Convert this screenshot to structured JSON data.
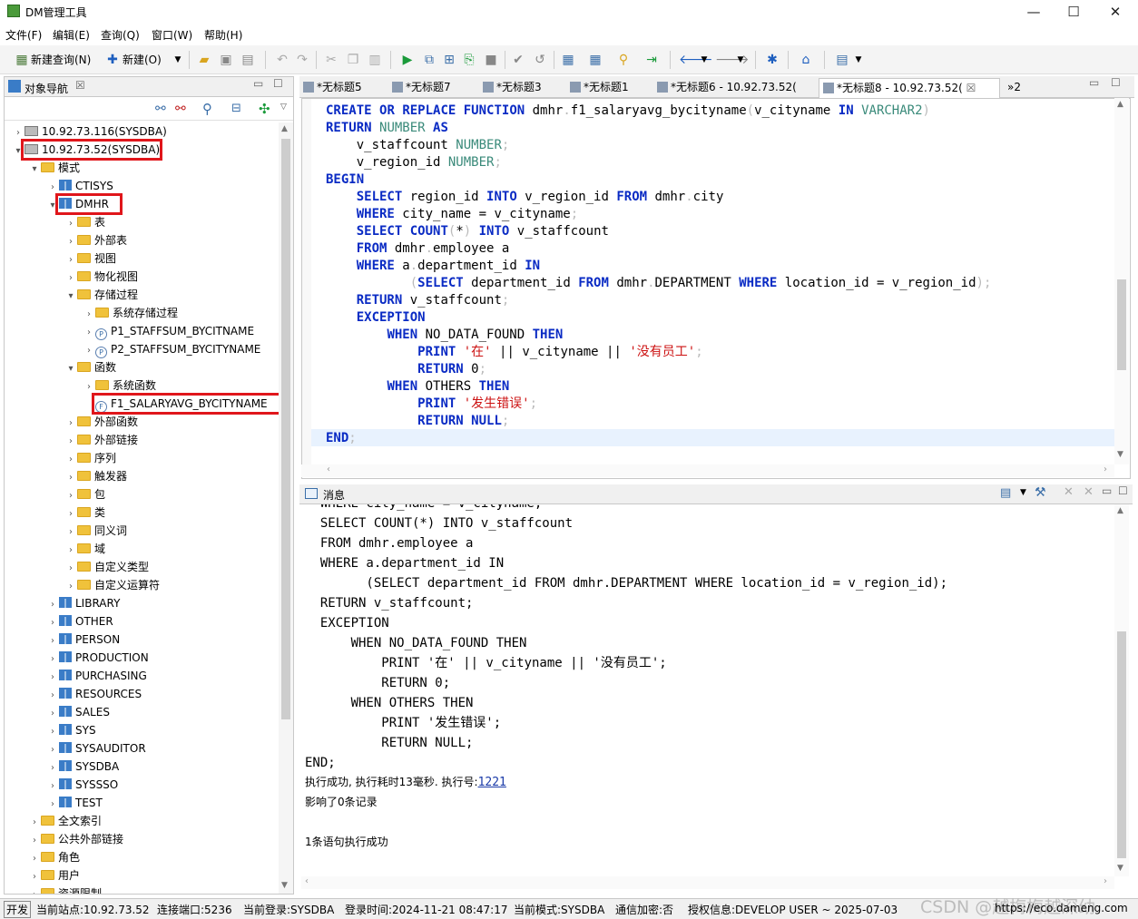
{
  "window": {
    "title": "DM管理工具",
    "controls": [
      "—",
      "☐",
      "✕"
    ]
  },
  "menu": [
    "文件(F)",
    "编辑(E)",
    "查询(Q)",
    "窗口(W)",
    "帮助(H)"
  ],
  "toolbar": {
    "new_query": "新建查询(N)",
    "new": "新建(O)"
  },
  "left_panel": {
    "tab_label": "对象导航",
    "tree": [
      {
        "level": 0,
        "arrow": "›",
        "icon": "server",
        "label": "10.92.73.116(SYSDBA)"
      },
      {
        "level": 0,
        "arrow": "⌄",
        "icon": "server",
        "label": "10.92.73.52(SYSDBA)",
        "highlight": true
      },
      {
        "level": 1,
        "arrow": "⌄",
        "icon": "folder",
        "label": "模式"
      },
      {
        "level": 2,
        "arrow": "›",
        "icon": "schema",
        "label": "CTISYS"
      },
      {
        "level": 2,
        "arrow": "⌄",
        "icon": "schema",
        "label": "DMHR",
        "highlight": true
      },
      {
        "level": 3,
        "arrow": "›",
        "icon": "folder",
        "label": "表"
      },
      {
        "level": 3,
        "arrow": "›",
        "icon": "folder",
        "label": "外部表"
      },
      {
        "level": 3,
        "arrow": "›",
        "icon": "folder",
        "label": "视图"
      },
      {
        "level": 3,
        "arrow": "›",
        "icon": "folder",
        "label": "物化视图"
      },
      {
        "level": 3,
        "arrow": "⌄",
        "icon": "folder",
        "label": "存储过程"
      },
      {
        "level": 4,
        "arrow": "›",
        "icon": "folder",
        "label": "系统存储过程"
      },
      {
        "level": 4,
        "arrow": "›",
        "icon": "proc",
        "label": "P1_STAFFSUM_BYCITNAME"
      },
      {
        "level": 4,
        "arrow": "›",
        "icon": "proc",
        "label": "P2_STAFFSUM_BYCITYNAME"
      },
      {
        "level": 3,
        "arrow": "⌄",
        "icon": "folder",
        "label": "函数"
      },
      {
        "level": 4,
        "arrow": "›",
        "icon": "folder",
        "label": "系统函数"
      },
      {
        "level": 4,
        "arrow": "",
        "icon": "func",
        "label": "F1_SALARYAVG_BYCITYNAME",
        "highlight": true
      },
      {
        "level": 3,
        "arrow": "›",
        "icon": "folder",
        "label": "外部函数"
      },
      {
        "level": 3,
        "arrow": "›",
        "icon": "folder",
        "label": "外部链接"
      },
      {
        "level": 3,
        "arrow": "›",
        "icon": "folder",
        "label": "序列"
      },
      {
        "level": 3,
        "arrow": "›",
        "icon": "folder",
        "label": "触发器"
      },
      {
        "level": 3,
        "arrow": "›",
        "icon": "folder",
        "label": "包"
      },
      {
        "level": 3,
        "arrow": "›",
        "icon": "folder",
        "label": "类"
      },
      {
        "level": 3,
        "arrow": "›",
        "icon": "folder",
        "label": "同义词"
      },
      {
        "level": 3,
        "arrow": "›",
        "icon": "folder",
        "label": "域"
      },
      {
        "level": 3,
        "arrow": "›",
        "icon": "folder",
        "label": "自定义类型"
      },
      {
        "level": 3,
        "arrow": "›",
        "icon": "folder",
        "label": "自定义运算符"
      },
      {
        "level": 2,
        "arrow": "›",
        "icon": "schema",
        "label": "LIBRARY"
      },
      {
        "level": 2,
        "arrow": "›",
        "icon": "schema",
        "label": "OTHER"
      },
      {
        "level": 2,
        "arrow": "›",
        "icon": "schema",
        "label": "PERSON"
      },
      {
        "level": 2,
        "arrow": "›",
        "icon": "schema",
        "label": "PRODUCTION"
      },
      {
        "level": 2,
        "arrow": "›",
        "icon": "schema",
        "label": "PURCHASING"
      },
      {
        "level": 2,
        "arrow": "›",
        "icon": "schema",
        "label": "RESOURCES"
      },
      {
        "level": 2,
        "arrow": "›",
        "icon": "schema",
        "label": "SALES"
      },
      {
        "level": 2,
        "arrow": "›",
        "icon": "schema",
        "label": "SYS"
      },
      {
        "level": 2,
        "arrow": "›",
        "icon": "schema",
        "label": "SYSAUDITOR"
      },
      {
        "level": 2,
        "arrow": "›",
        "icon": "schema",
        "label": "SYSDBA"
      },
      {
        "level": 2,
        "arrow": "›",
        "icon": "schema",
        "label": "SYSSSO"
      },
      {
        "level": 2,
        "arrow": "›",
        "icon": "schema",
        "label": "TEST"
      },
      {
        "level": 1,
        "arrow": "›",
        "icon": "folder",
        "label": "全文索引"
      },
      {
        "level": 1,
        "arrow": "›",
        "icon": "folder",
        "label": "公共外部链接"
      },
      {
        "level": 1,
        "arrow": "›",
        "icon": "folder",
        "label": "角色"
      },
      {
        "level": 1,
        "arrow": "›",
        "icon": "folder",
        "label": "用户"
      },
      {
        "level": 1,
        "arrow": "›",
        "icon": "folder",
        "label": "资源限制"
      }
    ]
  },
  "editor_tabs": [
    "*无标题5",
    "*无标题7",
    "*无标题3",
    "*无标题1",
    "*无标题6 - 10.92.73.52(",
    "*无标题8 - 10.92.73.52(",
    "»2"
  ],
  "editor_lines": [
    [
      [
        "k",
        "CREATE "
      ],
      [
        "k",
        "OR "
      ],
      [
        "k",
        "REPLACE "
      ],
      [
        "k",
        "FUNCTION "
      ],
      [
        "n",
        "dmhr"
      ],
      [
        "g",
        "."
      ],
      [
        "n",
        "f1_salaryavg_bycityname"
      ],
      [
        "g",
        "("
      ],
      [
        "n",
        "v_cityname "
      ],
      [
        "k",
        "IN "
      ],
      [
        "t",
        "VARCHAR2"
      ],
      [
        "g",
        ")"
      ]
    ],
    [
      [
        "k",
        "RETURN "
      ],
      [
        "t",
        "NUMBER "
      ],
      [
        "k",
        "AS"
      ]
    ],
    [
      [
        "n",
        "    v_staffcount "
      ],
      [
        "t",
        "NUMBER"
      ],
      [
        "g",
        ";"
      ]
    ],
    [
      [
        "n",
        "    v_region_id "
      ],
      [
        "t",
        "NUMBER"
      ],
      [
        "g",
        ";"
      ]
    ],
    [
      [
        "k",
        "BEGIN"
      ]
    ],
    [
      [
        "n",
        "    "
      ],
      [
        "k",
        "SELECT "
      ],
      [
        "n",
        "region_id "
      ],
      [
        "k",
        "INTO "
      ],
      [
        "n",
        "v_region_id "
      ],
      [
        "k",
        "FROM "
      ],
      [
        "n",
        "dmhr"
      ],
      [
        "g",
        "."
      ],
      [
        "n",
        "city"
      ]
    ],
    [
      [
        "n",
        "    "
      ],
      [
        "k",
        "WHERE "
      ],
      [
        "n",
        "city_name "
      ],
      [
        "n",
        "= "
      ],
      [
        "n",
        "v_cityname"
      ],
      [
        "g",
        ";"
      ]
    ],
    [
      [
        "n",
        "    "
      ],
      [
        "k",
        "SELECT "
      ],
      [
        "k",
        "COUNT"
      ],
      [
        "g",
        "("
      ],
      [
        "n",
        "*"
      ],
      [
        "g",
        ") "
      ],
      [
        "k",
        "INTO "
      ],
      [
        "n",
        "v_staffcount"
      ]
    ],
    [
      [
        "n",
        "    "
      ],
      [
        "k",
        "FROM "
      ],
      [
        "n",
        "dmhr"
      ],
      [
        "g",
        "."
      ],
      [
        "n",
        "employee a"
      ]
    ],
    [
      [
        "n",
        "    "
      ],
      [
        "k",
        "WHERE "
      ],
      [
        "n",
        "a"
      ],
      [
        "g",
        "."
      ],
      [
        "n",
        "department_id "
      ],
      [
        "k",
        "IN"
      ]
    ],
    [
      [
        "n",
        "           "
      ],
      [
        "g",
        "("
      ],
      [
        "k",
        "SELECT "
      ],
      [
        "n",
        "department_id "
      ],
      [
        "k",
        "FROM "
      ],
      [
        "n",
        "dmhr"
      ],
      [
        "g",
        "."
      ],
      [
        "n",
        "DEPARTMENT "
      ],
      [
        "k",
        "WHERE "
      ],
      [
        "n",
        "location_id = v_region_id"
      ],
      [
        "g",
        ");"
      ]
    ],
    [
      [
        "n",
        "    "
      ],
      [
        "k",
        "RETURN "
      ],
      [
        "n",
        "v_staffcount"
      ],
      [
        "g",
        ";"
      ]
    ],
    [
      [
        "n",
        "    "
      ],
      [
        "k",
        "EXCEPTION"
      ]
    ],
    [
      [
        "n",
        "        "
      ],
      [
        "k",
        "WHEN "
      ],
      [
        "n",
        "NO_DATA_FOUND "
      ],
      [
        "k",
        "THEN"
      ]
    ],
    [
      [
        "n",
        "            "
      ],
      [
        "k",
        "PRINT "
      ],
      [
        "s",
        "'在' "
      ],
      [
        "n",
        "|| v_cityname || "
      ],
      [
        "s",
        "'没有员工'"
      ],
      [
        "g",
        ";"
      ]
    ],
    [
      [
        "n",
        "            "
      ],
      [
        "k",
        "RETURN "
      ],
      [
        "n",
        "0"
      ],
      [
        "g",
        ";"
      ]
    ],
    [
      [
        "n",
        "        "
      ],
      [
        "k",
        "WHEN "
      ],
      [
        "n",
        "OTHERS "
      ],
      [
        "k",
        "THEN"
      ]
    ],
    [
      [
        "n",
        "            "
      ],
      [
        "k",
        "PRINT "
      ],
      [
        "s",
        "'发生错误'"
      ],
      [
        "g",
        ";"
      ]
    ],
    [
      [
        "n",
        "            "
      ],
      [
        "k",
        "RETURN "
      ],
      [
        "k",
        "NULL"
      ],
      [
        "g",
        ";"
      ]
    ],
    [
      [
        "k",
        "END"
      ],
      [
        "g",
        ";"
      ]
    ]
  ],
  "message_panel": {
    "tab_label": "消息",
    "code_lines": [
      "  WHERE city_name = v_cityname;",
      "  SELECT COUNT(*) INTO v_staffcount",
      "  FROM dmhr.employee a",
      "  WHERE a.department_id IN",
      "        (SELECT department_id FROM dmhr.DEPARTMENT WHERE location_id = v_region_id);",
      "  RETURN v_staffcount;",
      "  EXCEPTION",
      "      WHEN NO_DATA_FOUND THEN",
      "          PRINT '在' || v_cityname || '没有员工';",
      "          RETURN 0;",
      "      WHEN OTHERS THEN",
      "          PRINT '发生错误';",
      "          RETURN NULL;",
      "END;"
    ],
    "result_prefix": "执行成功, 执行耗时13毫秒. 执行号:",
    "exec_number": "1221",
    "affected": "影响了0条记录",
    "summary": "1条语句执行成功"
  },
  "status_bar": {
    "mode": "开发",
    "site": "当前站点:10.92.73.52",
    "port": "连接端口:5236",
    "login": "当前登录:SYSDBA",
    "login_time": "登录时间:2024-11-21 08:47:17",
    "schema": "当前模式:SYSDBA",
    "encryption": "通信加密:否",
    "license": "授权信息:DEVELOP USER ~ 2025-07-03",
    "url": "https://eco.dameng.com",
    "watermark": "CSDN @越梅梅越深幼"
  }
}
